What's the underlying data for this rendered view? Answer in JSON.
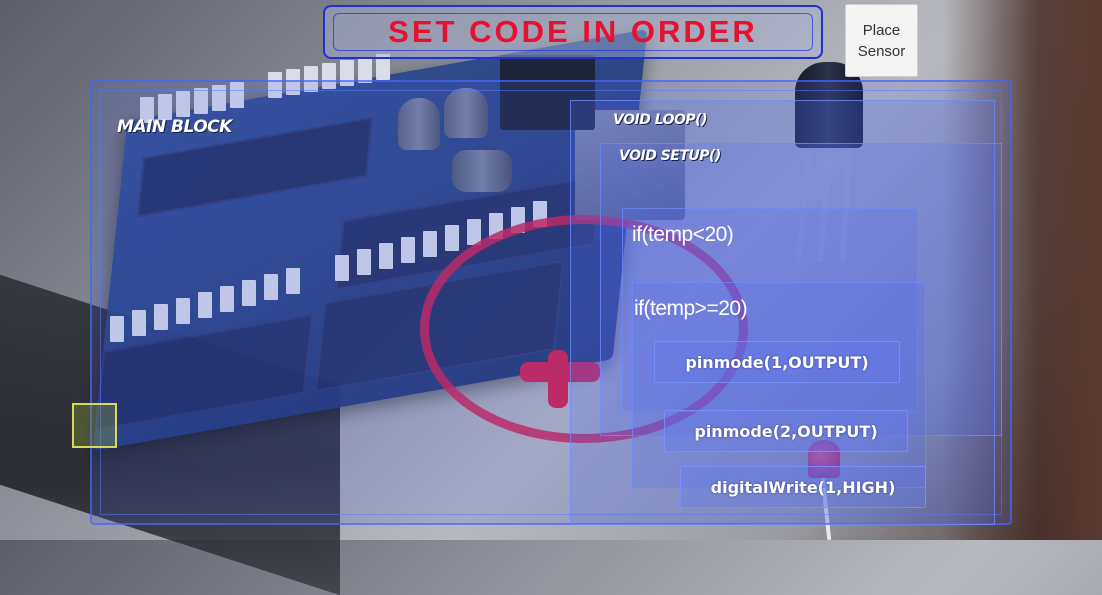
{
  "title": "SET CODE IN ORDER",
  "place_sensor_button": {
    "line1": "Place",
    "line2": "Sensor"
  },
  "blocks": {
    "main_block": "MAIN BLOCK",
    "void_loop": "VOID LOOP()",
    "void_setup": "VOID SETUP()"
  },
  "code_items": {
    "if_temp_lt": "if(temp<20)",
    "if_temp_ge": "if(temp>=20)",
    "pinmode_1": "pinmode(1,OUTPUT)",
    "pinmode_2": "pinmode(2,OUTPUT)",
    "digitalwrite_1": "digitalWrite(1,HIGH)"
  },
  "colors": {
    "title_red": "#e8102f",
    "frame_blue": "#4664ff",
    "target_red": "#d3204e",
    "slot_yellow": "#d7d95a"
  },
  "icons": [
    "arduino-board",
    "transistor-sensor",
    "led",
    "target-reticle"
  ]
}
